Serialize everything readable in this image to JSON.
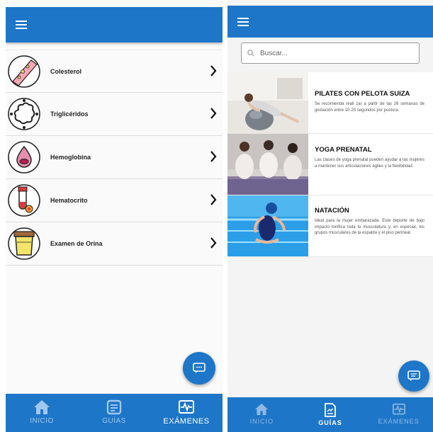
{
  "colors": {
    "primary": "#1e76c8",
    "nav_inactive": "#9ec8ee"
  },
  "exams_screen": {
    "menu_icon": "hamburger-icon",
    "items": [
      {
        "label": "Colesterol",
        "icon": "artery-icon"
      },
      {
        "label": "Triglicéridos",
        "icon": "fat-molecule-icon"
      },
      {
        "label": "Hemoglobina",
        "icon": "blood-drop-icon"
      },
      {
        "label": "Hematocrito",
        "icon": "test-tube-icon"
      },
      {
        "label": "Examen de Orina",
        "icon": "urine-cup-icon"
      }
    ],
    "fab_icon": "chat-icon",
    "nav": [
      {
        "label": "INICIO",
        "icon": "home-icon"
      },
      {
        "label": "GUÍAS",
        "icon": "document-icon"
      },
      {
        "label": "EXÁMENES",
        "icon": "pulse-icon",
        "active": true
      }
    ]
  },
  "guides_screen": {
    "menu_icon": "hamburger-icon",
    "search": {
      "placeholder": "Buscar..."
    },
    "guides": [
      {
        "title": "PILATES CON PELOTA SUIZA",
        "description": "Se recomienda reali zar a partir de las 26 semanas de gestación entre 10-25 segundos por postura."
      },
      {
        "title": "YOGA PRENATAL",
        "description": "Las clases de yoga prenatal pueden ayudar a las mujeres a mantener sus articulaciones ágiles y la flexibilidad."
      },
      {
        "title": "NATACIÓN",
        "description": "Ideal para la mujer embarazada. Este deporte de bajo impacto tonifica toda la musculatura y, en especial, los grupos musculares de la espalda y el piso perineal."
      }
    ],
    "fab_icon": "chat-icon",
    "nav": [
      {
        "label": "INICIO",
        "icon": "home-icon"
      },
      {
        "label": "GUÍAS",
        "icon": "document-icon",
        "active": true
      },
      {
        "label": "EXÁMENES",
        "icon": "pulse-icon"
      }
    ]
  }
}
